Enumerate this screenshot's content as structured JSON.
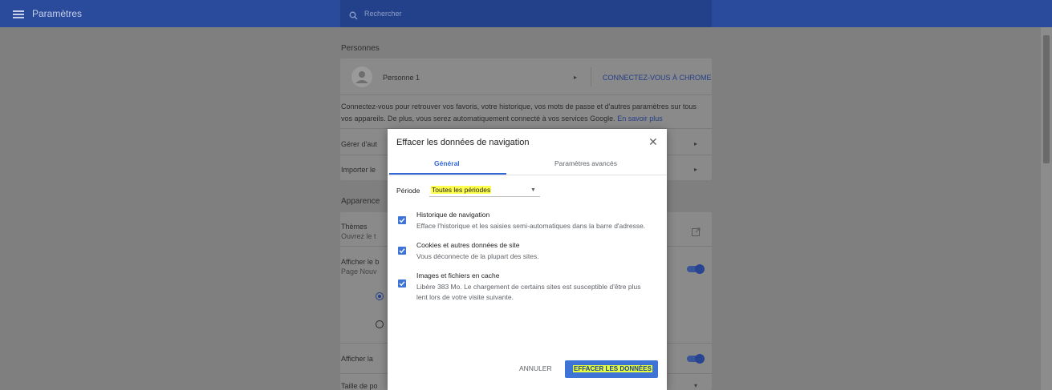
{
  "header": {
    "title": "Paramètres",
    "search_placeholder": "Rechercher"
  },
  "people_section": {
    "title": "Personnes",
    "person_name": "Personne 1",
    "connect_button": "CONNECTEZ-VOUS À CHROME",
    "description": "Connectez-vous pour retrouver vos favoris, votre historique, vos mots de passe et d'autres paramètres sur tous",
    "description_line2": "vos appareils. De plus, vous serez automatiquement connecté à vos services Google.",
    "learn_more": "En savoir plus",
    "row_manage": "Gérer d'aut",
    "row_import": "Importer le"
  },
  "appearance_section": {
    "title": "Apparence",
    "themes_label": "Thèmes",
    "themes_sub": "Ouvrez le t",
    "show_home_label": "Afficher le b",
    "show_home_sub": "Page Nouv",
    "show_bookmarks_label": "Afficher la",
    "font_size_label": "Taille de po"
  },
  "dialog": {
    "title": "Effacer les données de navigation",
    "close_glyph": "✕",
    "tabs": [
      {
        "label": "Général"
      },
      {
        "label": "Paramètres avancés"
      }
    ],
    "period_label": "Période",
    "period_value": "Toutes les périodes",
    "items": [
      {
        "title": "Historique de navigation",
        "desc": "Efface l'historique et les saisies semi-automatiques dans la barre d'adresse."
      },
      {
        "title": "Cookies et autres données de site",
        "desc": "Vous déconnecte de la plupart des sites."
      },
      {
        "title": "Images et fichiers en cache",
        "desc": "Libère 383 Mo. Le chargement de certains sites est susceptible d'être plus",
        "desc2": "lent lors de votre visite suivante."
      }
    ],
    "cancel_label": "ANNULER",
    "clear_label": "EFFACER LES DONNÉES"
  },
  "colors": {
    "accent": "#3d74d6",
    "header": "#2a4a9b",
    "highlight": "#ffff4d"
  }
}
